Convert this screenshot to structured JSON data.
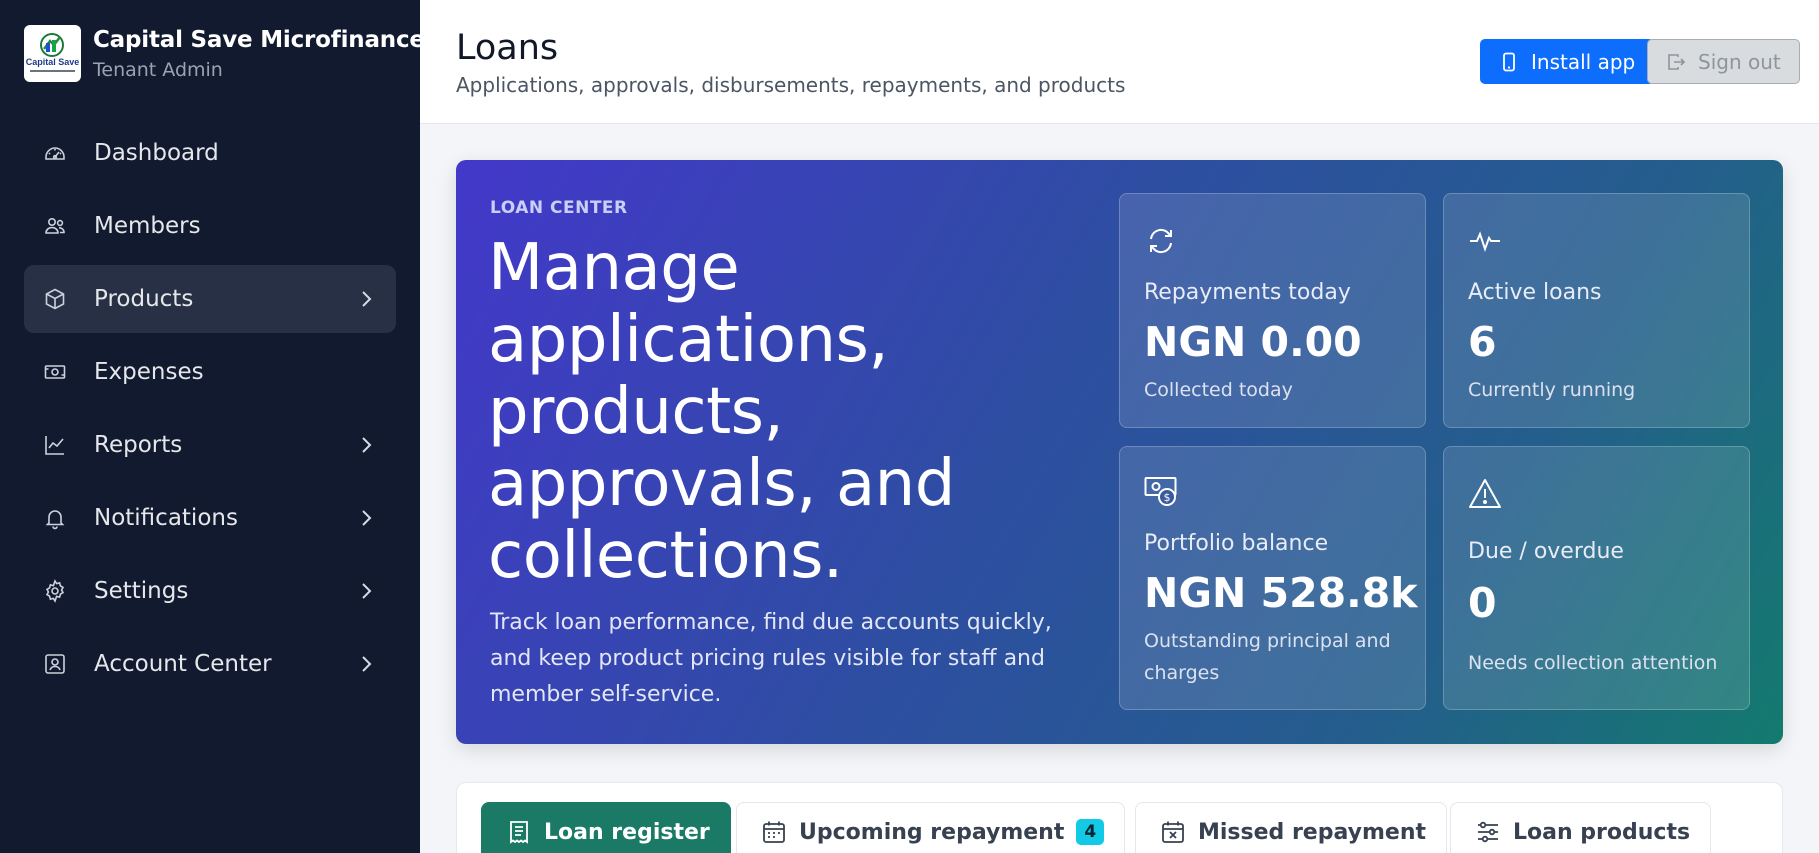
{
  "sidebar": {
    "brand": {
      "logo_text": "Capital Save",
      "title": "Capital Save Microfinance",
      "subtitle": "Tenant Admin"
    },
    "items": [
      {
        "label": "Dashboard",
        "icon": "speedometer-icon",
        "has_chevron": false
      },
      {
        "label": "Members",
        "icon": "users-icon",
        "has_chevron": false
      },
      {
        "label": "Products",
        "icon": "box-icon",
        "has_chevron": true,
        "active": true
      },
      {
        "label": "Expenses",
        "icon": "cash-icon",
        "has_chevron": false
      },
      {
        "label": "Reports",
        "icon": "chart-line-icon",
        "has_chevron": true
      },
      {
        "label": "Notifications",
        "icon": "bell-icon",
        "has_chevron": true
      },
      {
        "label": "Settings",
        "icon": "gear-icon",
        "has_chevron": true
      },
      {
        "label": "Account Center",
        "icon": "person-badge-icon",
        "has_chevron": true
      }
    ]
  },
  "header": {
    "title": "Loans",
    "subtitle": "Applications, approvals, disbursements, repayments, and products",
    "install_label": "Install app",
    "signout_label": "Sign out"
  },
  "hero": {
    "eyebrow": "LOAN CENTER",
    "title": "Manage applications, products, approvals, and collections.",
    "description": "Track loan performance, find due accounts quickly, and keep product pricing rules visible for staff and member self-service.",
    "stats": [
      {
        "icon": "refresh-icon",
        "label": "Repayments today",
        "value": "NGN 0.00",
        "note": "Collected today"
      },
      {
        "icon": "activity-icon",
        "label": "Active loans",
        "value": "6",
        "note": "Currently running"
      },
      {
        "icon": "cash-coin-icon",
        "label": "Portfolio balance",
        "value": "NGN 528.8k",
        "note": "Outstanding principal and charges"
      },
      {
        "icon": "warning-triangle-icon",
        "label": "Due / overdue",
        "value": "0",
        "note": "Needs collection attention"
      }
    ]
  },
  "tabs": [
    {
      "label": "Loan register",
      "icon": "receipt-icon",
      "active": true
    },
    {
      "label": "Upcoming repayment",
      "icon": "calendar-week-icon",
      "badge": "4"
    },
    {
      "label": "Missed repayment",
      "icon": "calendar-x-icon"
    },
    {
      "label": "Loan products",
      "icon": "sliders-icon"
    }
  ],
  "colors": {
    "sidebar_bg": "#111a2e",
    "primary": "#0d6efd",
    "tab_active": "#1a7a66",
    "badge": "#12c9e6"
  }
}
